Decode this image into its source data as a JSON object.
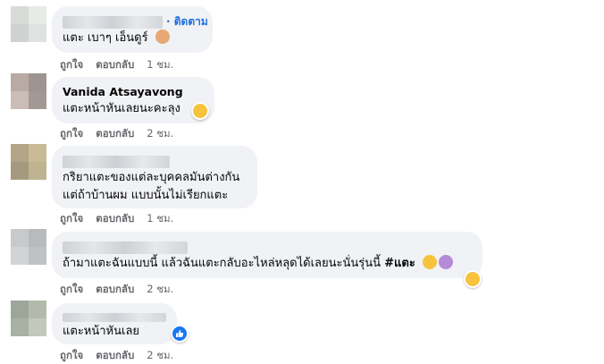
{
  "actions": {
    "like": "ถูกใจ",
    "reply": "ตอบกลับ"
  },
  "comments": [
    {
      "follow": "· ติดตาม",
      "text": "แตะ เบาๆ เอ็นดูร์",
      "time": "1 ชม.",
      "text_emoji": "person-shrugging-emoji"
    },
    {
      "author": "Vanida Atsayavong",
      "text": "แตะหน้าหันเลยนะคะลุง",
      "time": "2 ชม.",
      "reaction": "laughing-emoji"
    },
    {
      "lines": [
        "กริยาแตะของแต่ละบุคคลมันต่างกัน",
        "แต่ถ้าบ้านผม แบบนั้นไม่เรียกแตะ"
      ],
      "time": "1 ชม."
    },
    {
      "text": "ถ้ามาแตะฉันแบบนี้ แล้วฉันแตะกลับอะไหล่หลุดได้เลยนะนั่นรุ่นนี้",
      "hashtag": "#แตะ",
      "time": "2 ชม.",
      "text_emojis": [
        "rolling-eyes-emoji",
        "woman-gesturing-emoji"
      ],
      "reaction": "laughing-emoji"
    },
    {
      "text": "แตะหน้าหันเลย",
      "time": "2 ชม.",
      "reaction": "like-reaction-icon"
    }
  ],
  "colors": {
    "bubble": "#f0f2f5",
    "link": "#216fdb",
    "meta": "#65676b",
    "like": "#1877f2"
  }
}
